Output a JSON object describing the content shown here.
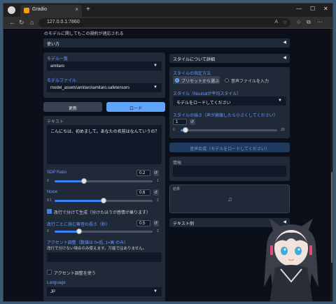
{
  "browser": {
    "tab_title": "Gradio",
    "tab_close": "×",
    "new_tab": "+",
    "url": "127.0.0.1:7860",
    "url_zoom": "A",
    "min": "—",
    "max": "☐",
    "close": "✕"
  },
  "top_text": "のモデルに関してもこの規約が適応される",
  "usage_accordion": "使い方",
  "left": {
    "model_list_label": "モデル一覧",
    "model_list_value": "amitaro",
    "model_file_label": "モデルファイル",
    "model_file_value": "model_assets\\amitaro\\amitaro.safetensors",
    "refresh_button": "更新",
    "load_button": "ロード",
    "text_label": "テキスト",
    "text_value": "こんにちは、初めまして。あなたの名前はなんていうの？",
    "sdp_label": "SDP Ratio",
    "sdp_value": "0.2",
    "sdp_min": "0",
    "sdp_max": "1",
    "noise_label": "Noise",
    "noise_value": "0.6",
    "noise_min": "0.1",
    "noise_max": "2",
    "noisew_label": "Noise_W",
    "noisew_value": "0.8",
    "noisew_min": "0.1",
    "noisew_max": "2",
    "line_split_label": "改行で分けて生成（分けたほうが感情が乗ります）",
    "split_interval_label": "改行ごとに挟む無音の長さ（秒）",
    "split_interval_value": "0.5",
    "split_min": "0",
    "split_max": "2",
    "accent_title": "アクセント調整（数値は 0=低, 1=高 のみ）",
    "accent_note": "改行で分けない場合のみ使えます。万能ではありません。",
    "use_accent_label": "アクセント調整を使う",
    "language_label": "Language",
    "language_value": "JP"
  },
  "right": {
    "style_detail_accordion": "スタイルについて詳細",
    "style_method_label": "スタイルの指定方法",
    "style_option_preset": "プリセットから選ぶ",
    "style_option_audio": "音声ファイルを入力",
    "style_label": "スタイル（Neutralが平均スタイル）",
    "style_value": "モデルをロードしてください",
    "style_weight_label": "スタイルの強さ（声が崩壊したら小さくしてください）",
    "style_weight_value": "1",
    "style_weight_min": "0",
    "style_weight_max": "20",
    "synth_button": "音声合成（モデルをロードしてください）",
    "info_label": "情報",
    "audio_label": "結果",
    "audio_icon": "♫",
    "text_examples_accordion": "テキスト例"
  },
  "accent_color": "#3b82f6"
}
